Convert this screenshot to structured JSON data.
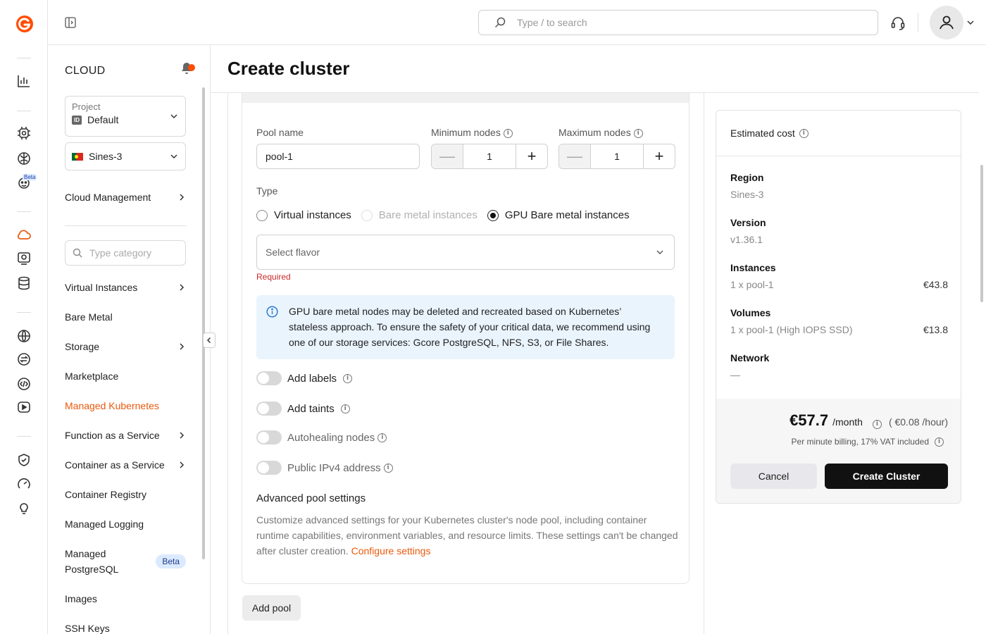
{
  "topbar": {
    "search_placeholder": "Type / to search"
  },
  "sidebar": {
    "title": "CLOUD",
    "project_label": "Project",
    "project_badge": "ID",
    "project_value": "Default",
    "region_value": "Sines-3",
    "cloud_management": "Cloud Management",
    "category_placeholder": "Type category",
    "items": [
      {
        "label": "Virtual Instances",
        "chevron": true
      },
      {
        "label": "Bare Metal",
        "chevron": false
      },
      {
        "label": "Storage",
        "chevron": true
      },
      {
        "label": "Marketplace",
        "chevron": false
      },
      {
        "label": "Managed Kubernetes",
        "chevron": false,
        "active": true
      },
      {
        "label": "Function as a Service",
        "chevron": true
      },
      {
        "label": "Container as a Service",
        "chevron": true
      },
      {
        "label": "Container Registry",
        "chevron": false
      },
      {
        "label": "Managed Logging",
        "chevron": false
      },
      {
        "label": "Managed PostgreSQL",
        "badge": "Beta"
      },
      {
        "label": "Images",
        "chevron": false
      },
      {
        "label": "SSH Keys",
        "chevron": false
      }
    ],
    "rail_beta": "Beta"
  },
  "page": {
    "title": "Create cluster"
  },
  "pool": {
    "name_label": "Pool name",
    "name_value": "pool-1",
    "min_label": "Minimum nodes",
    "min_value": "1",
    "max_label": "Maximum nodes",
    "max_value": "1",
    "type_label": "Type",
    "types": [
      {
        "label": "Virtual instances",
        "state": "unchecked"
      },
      {
        "label": "Bare metal instances",
        "state": "disabled"
      },
      {
        "label": "GPU Bare metal instances",
        "state": "checked"
      }
    ],
    "flavor_placeholder": "Select flavor",
    "required_text": "Required",
    "info_text": "GPU bare metal nodes may be deleted and recreated based on Kubernetes’ stateless approach. To ensure the safety of your critical data, we recommend using one of our storage services: Gcore PostgreSQL, NFS, S3, or File Shares.",
    "toggles": [
      {
        "label": "Add labels",
        "on": false
      },
      {
        "label": "Add taints",
        "on": false
      },
      {
        "label": "Autohealing nodes",
        "on": false
      },
      {
        "label": "Public IPv4 address",
        "on": false
      }
    ],
    "advanced_title": "Advanced pool settings",
    "advanced_desc": "Customize advanced settings for your Kubernetes cluster's node pool, including container runtime capabilities, environment variables, and resource limits. These settings can't be changed after cluster creation.",
    "advanced_link": "Configure settings",
    "add_pool": "Add pool"
  },
  "cost": {
    "title": "Estimated cost",
    "region_label": "Region",
    "region_value": "Sines-3",
    "version_label": "Version",
    "version_value": "v1.36.1",
    "instances_label": "Instances",
    "instances_value": "1 x pool-1",
    "instances_price": "€43.8",
    "volumes_label": "Volumes",
    "volumes_value": "1 x pool-1 (High IOPS SSD)",
    "volumes_price": "€13.8",
    "network_label": "Network",
    "network_value": "—",
    "total": "€57.7",
    "per_month": "/month",
    "hourly": "( €0.08 /hour)",
    "billing_note": "Per minute billing, 17% VAT included",
    "cancel": "Cancel",
    "create": "Create Cluster"
  },
  "colors": {
    "accent": "#e8590c",
    "primary_button": "#111111",
    "info_bg": "#eaf4fd",
    "error": "#c92a2a"
  }
}
